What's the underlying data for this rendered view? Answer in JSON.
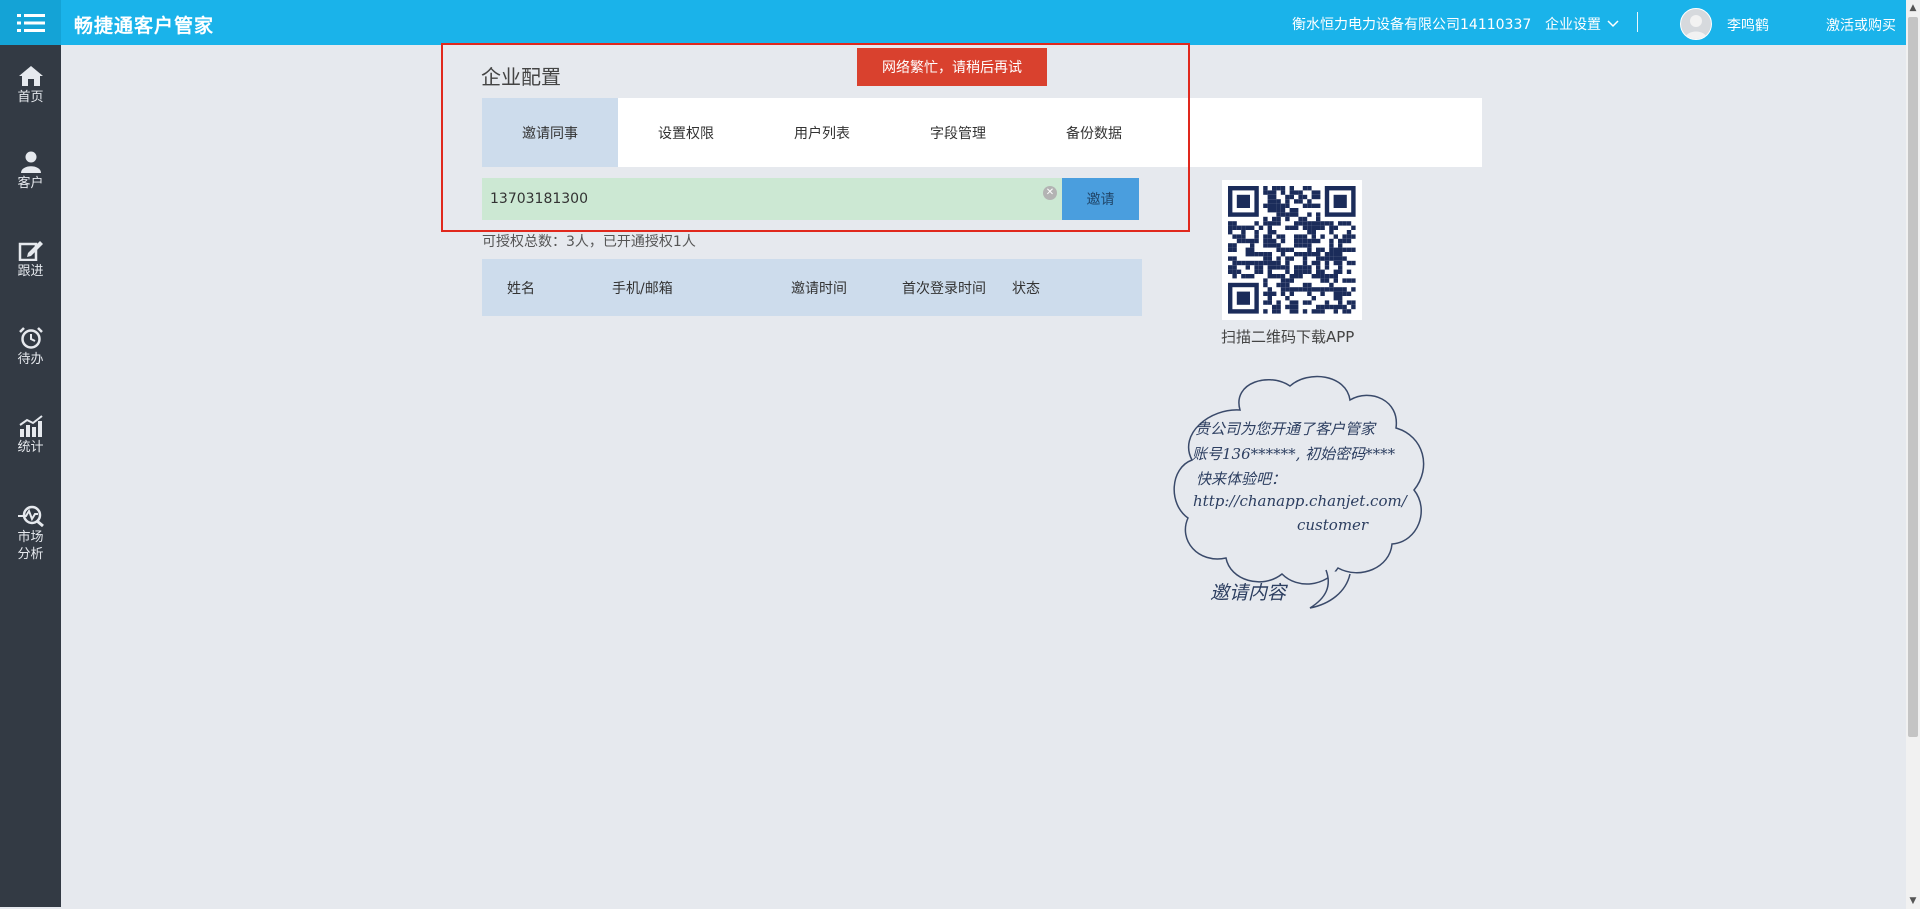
{
  "header": {
    "app_title": "畅捷通客户管家",
    "company": "衡水恒力电力设备有限公司14110337",
    "settings_label": "企业设置",
    "user_name": "李鸣鹤",
    "activate_label": "激活或购买"
  },
  "sidebar": {
    "items": [
      {
        "label": "首页",
        "icon": "home-icon"
      },
      {
        "label": "客户",
        "icon": "person-icon"
      },
      {
        "label": "跟进",
        "icon": "edit-icon"
      },
      {
        "label": "待办",
        "icon": "alarm-clock-icon"
      },
      {
        "label": "统计",
        "icon": "chart-icon"
      },
      {
        "label": "市场",
        "label2": "分析",
        "icon": "market-analysis-icon"
      }
    ]
  },
  "page": {
    "title": "企业配置",
    "tabs": [
      "邀请同事",
      "设置权限",
      "用户列表",
      "字段管理",
      "备份数据"
    ],
    "active_tab": 0,
    "invite_value": "13703181300",
    "invite_button": "邀请",
    "quota_text": "可授权总数：3人，已开通授权1人",
    "table_headers": [
      "姓名",
      "手机/邮箱",
      "邀请时间",
      "首次登录时间",
      "状态"
    ],
    "toast": "网络繁忙，请稍后再试"
  },
  "qr": {
    "label": "扫描二维码下载APP"
  },
  "cloud": {
    "line1": "贵公司为您开通了客户管家",
    "line2": "账号136******, 初始密码****",
    "line3": "快来体验吧：",
    "line4": "http://chanapp.chanjet.com/",
    "line5": "customer",
    "caption": "邀请内容"
  },
  "colors": {
    "topbar": "#1ab3ea",
    "sidebar": "#333a44",
    "accent": "#4a9ede",
    "alert": "#d9412e",
    "highlight_border": "#e0281d"
  }
}
